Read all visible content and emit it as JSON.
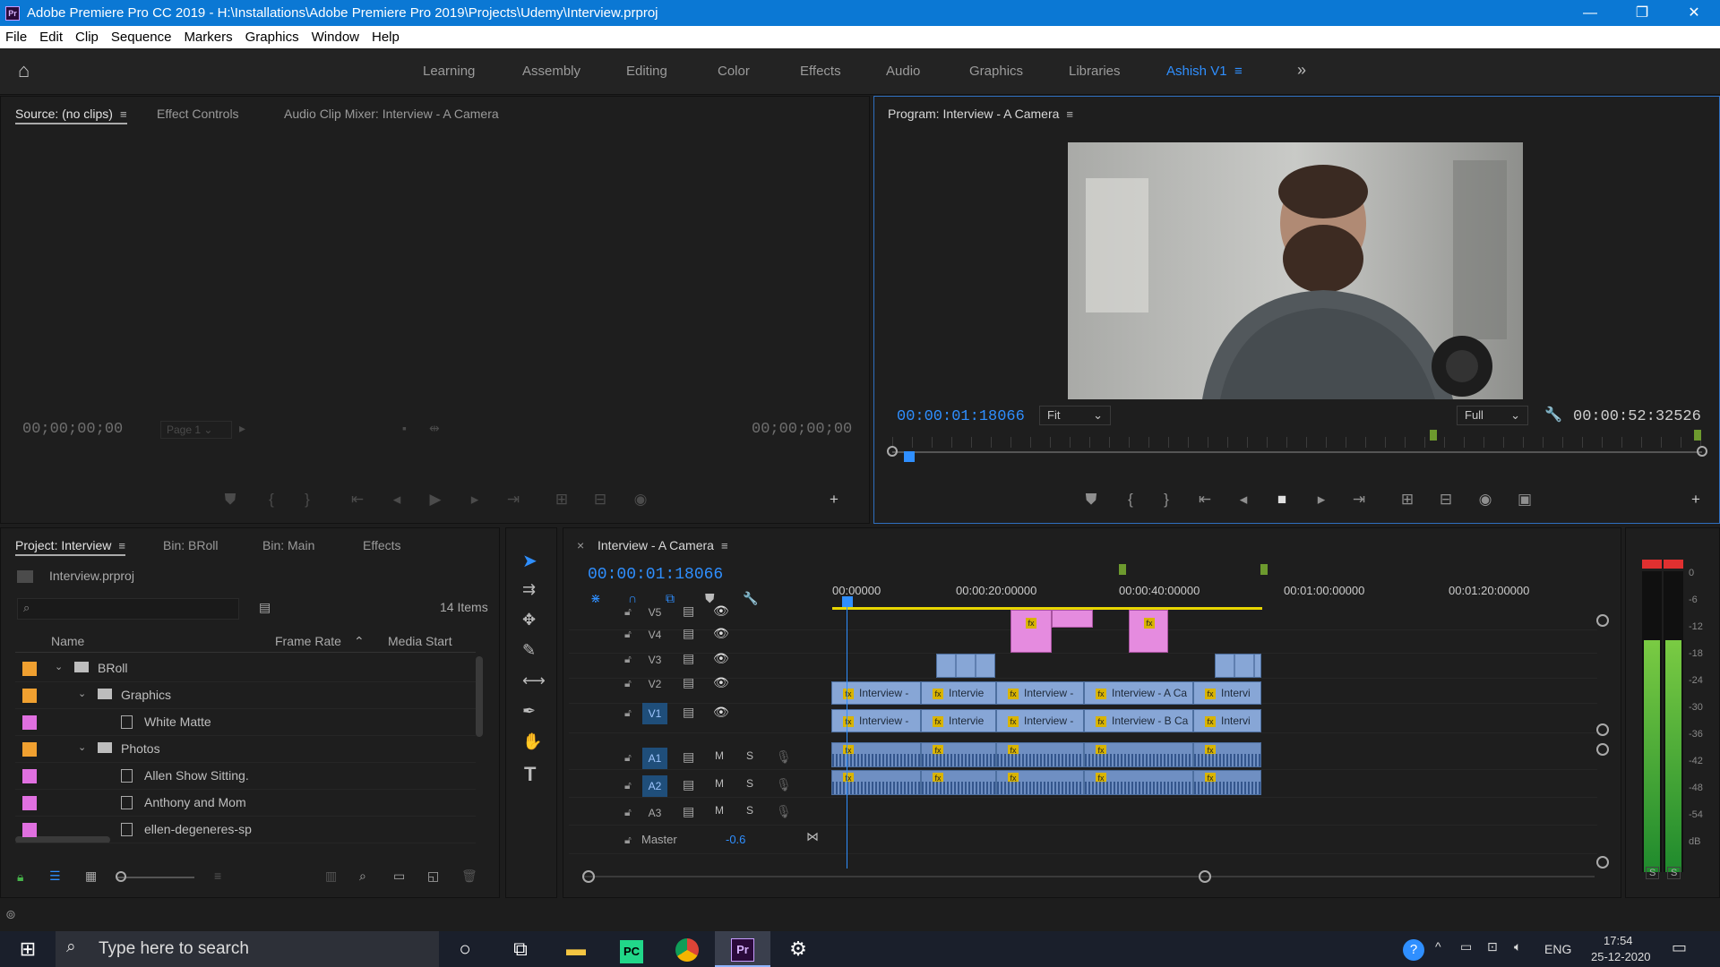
{
  "window": {
    "title": "Adobe Premiere Pro CC 2019 - H:\\Installations\\Adobe Premiere Pro 2019\\Projects\\Udemy\\Interview.prproj",
    "app_icon_label": "Pr",
    "minimize": "—",
    "restore": "❐",
    "close": "✕"
  },
  "menu": [
    "File",
    "Edit",
    "Clip",
    "Sequence",
    "Markers",
    "Graphics",
    "Window",
    "Help"
  ],
  "workspaces": {
    "items": [
      "Learning",
      "Assembly",
      "Editing",
      "Color",
      "Effects",
      "Audio",
      "Graphics",
      "Libraries"
    ],
    "active": "Ashish V1",
    "overflow": "»"
  },
  "source_panel": {
    "tabs": [
      "Source: (no clips)",
      "Effect Controls",
      "Audio Clip Mixer: Interview - A Camera"
    ],
    "timecode_left": "00;00;00;00",
    "timecode_right": "00;00;00;00",
    "page_select": "Page 1"
  },
  "program_panel": {
    "tab": "Program: Interview - A Camera",
    "timecode_current": "00:00:01:18066",
    "zoom_select": "Fit",
    "quality_select": "Full",
    "timecode_duration": "00:00:52:32526"
  },
  "project_panel": {
    "tabs": [
      "Project: Interview",
      "Bin: BRoll",
      "Bin: Main",
      "Effects"
    ],
    "file_name": "Interview.prproj",
    "search_placeholder": "",
    "item_count": "14 Items",
    "columns": [
      "Name",
      "Frame Rate",
      "Media Start"
    ],
    "rows": [
      {
        "name": "BRoll",
        "indent": 0,
        "kind": "folder",
        "color": "#f0a030"
      },
      {
        "name": "Graphics",
        "indent": 1,
        "kind": "folder",
        "color": "#f0a030"
      },
      {
        "name": "White Matte",
        "indent": 2,
        "kind": "item",
        "color": "#e070e0"
      },
      {
        "name": "Photos",
        "indent": 1,
        "kind": "folder",
        "color": "#f0a030"
      },
      {
        "name": "Allen Show Sitting.",
        "indent": 2,
        "kind": "item",
        "color": "#e070e0"
      },
      {
        "name": "Anthony and Mom",
        "indent": 2,
        "kind": "item",
        "color": "#e070e0"
      },
      {
        "name": "ellen-degeneres-sp",
        "indent": 2,
        "kind": "item",
        "color": "#e070e0"
      }
    ]
  },
  "timeline": {
    "tab": "Interview - A Camera",
    "close": "×",
    "timecode": "00:00:01:18066",
    "ruler": [
      "00:00000",
      "00:00:20:00000",
      "00:00:40:00000",
      "00:01:00:00000",
      "00:01:20:00000"
    ],
    "video_tracks": [
      "V5",
      "V4",
      "V3",
      "V2",
      "V1"
    ],
    "audio_tracks": [
      "A1",
      "A2",
      "A3"
    ],
    "mute_label": "M",
    "solo_label": "S",
    "master_label": "Master",
    "master_value": "-0.6",
    "v2_clips": [
      "Interview -",
      "Intervie",
      "Interview -",
      "Interview - A Ca",
      "Intervi"
    ],
    "v1_clips": [
      "Interview -",
      "Intervie",
      "Interview -",
      "Interview - B Ca",
      "Intervi"
    ],
    "fx_label": "fx"
  },
  "audio_meter": {
    "scale": [
      "0",
      "-6",
      "-12",
      "-18",
      "-24",
      "-30",
      "-36",
      "-42",
      "-48",
      "-54",
      "dB"
    ],
    "solo_left": "S",
    "solo_right": "S"
  },
  "taskbar": {
    "search_placeholder": "Type here to search",
    "language": "ENG",
    "time": "17:54",
    "date": "25-12-2020"
  },
  "colors": {
    "accent": "#2f8fff",
    "titlebar": "#0b78d4",
    "video_clip": "#87a6d6",
    "graphic_clip": "#e58bdf",
    "playhead": "#2f8fff"
  }
}
